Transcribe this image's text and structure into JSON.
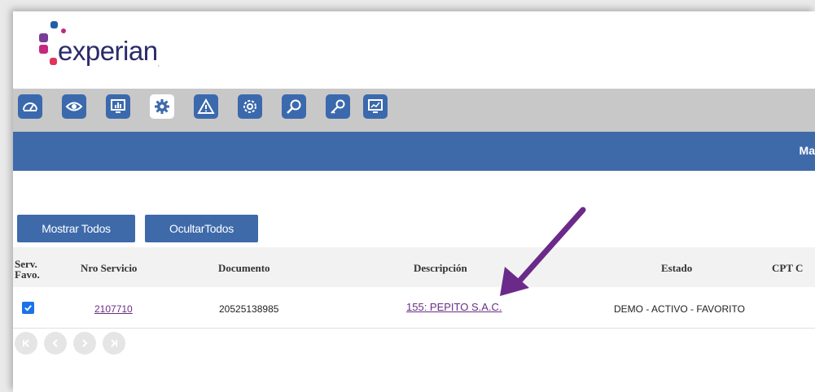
{
  "brand": {
    "name": "experian",
    "mark": "."
  },
  "toolbar": {
    "icons": [
      "dashboard-icon",
      "eye-icon",
      "monitor-chart-icon",
      "gear-icon",
      "warning-icon",
      "settings-cog-icon",
      "search-icon",
      "key-icon",
      "monitor-report-icon"
    ],
    "active_index": 3
  },
  "bluebar": {
    "title": "Ma"
  },
  "actions": {
    "show_all": "Mostrar Todos",
    "hide_all": "OcultarTodos"
  },
  "table": {
    "headers": {
      "fav_line1": "Serv.",
      "fav_line2": "Favo.",
      "nro_servicio": "Nro Servicio",
      "documento": "Documento",
      "descripcion": "Descripción",
      "estado": "Estado",
      "cpt": "CPT C"
    },
    "rows": [
      {
        "favorite": true,
        "nro_servicio": "2107710",
        "documento": "20525138985",
        "descripcion": "155: PEPITO S.A.C.",
        "estado": "DEMO - ACTIVO - FAVORITO"
      }
    ]
  },
  "pager": {
    "buttons": [
      "first",
      "prev",
      "next",
      "last"
    ]
  },
  "colors": {
    "primary": "#3e6aaa",
    "link": "#6a2c84",
    "arrow": "#6b2a8a",
    "toolbar_bg": "#c8c8c8"
  }
}
